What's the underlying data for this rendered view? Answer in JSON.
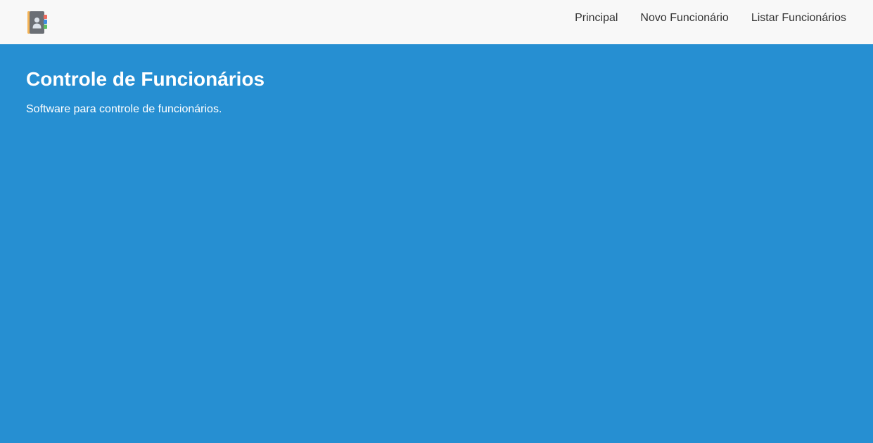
{
  "colors": {
    "navbar_bg": "#f8f8f8",
    "hero_bg": "#268fd2",
    "nav_text": "#333333",
    "hero_text": "#ffffff"
  },
  "navbar": {
    "logo_icon": "contact-book-icon",
    "links": [
      {
        "label": "Principal"
      },
      {
        "label": "Novo Funcionário"
      },
      {
        "label": "Listar Funcionários"
      }
    ]
  },
  "hero": {
    "title": "Controle de Funcionários",
    "subtitle": "Software para controle de funcionários."
  }
}
